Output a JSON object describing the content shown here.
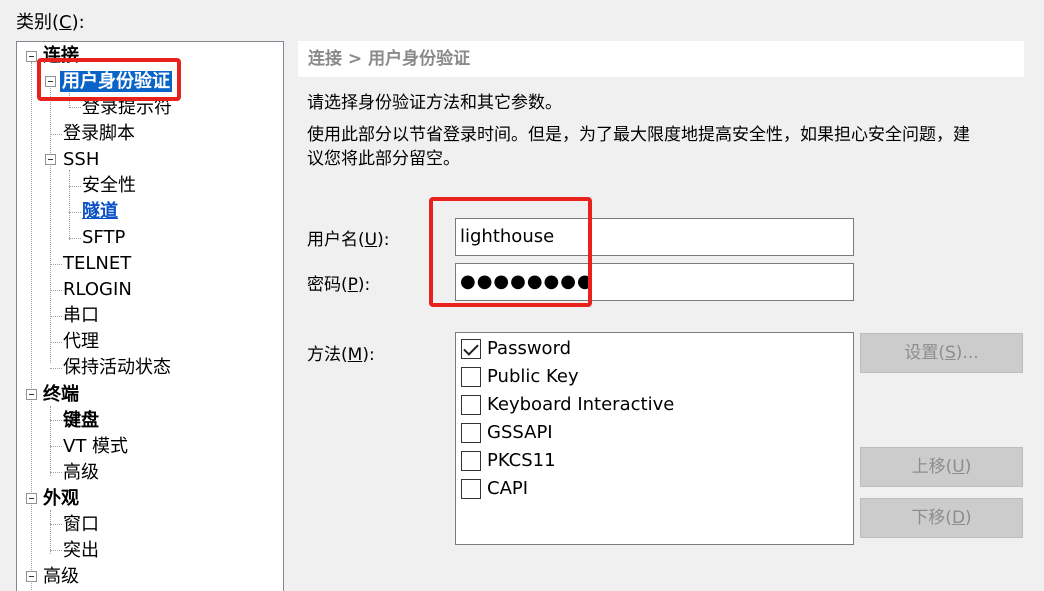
{
  "category": {
    "label": "类别(",
    "mnemonic": "C",
    "suffix": "):"
  },
  "tree": {
    "connection": "连接",
    "auth": "用户身份验证",
    "login_prompt": "登录提示符",
    "login_script": "登录脚本",
    "ssh": "SSH",
    "security": "安全性",
    "tunnel": "隧道",
    "sftp": "SFTP",
    "telnet": "TELNET",
    "rlogin": "RLOGIN",
    "serial": "串口",
    "proxy": "代理",
    "keepalive": "保持活动状态",
    "terminal": "终端",
    "keyboard": "键盘",
    "vt_mode": "VT 模式",
    "advanced_sub": "高级",
    "appearance": "外观",
    "window": "窗口",
    "highlight": "突出",
    "advanced": "高级"
  },
  "breadcrumb": "连接 > 用户身份验证",
  "description": {
    "line1": "请选择身份验证方法和其它参数。",
    "line2a": "使用此部分以节省登录时间。但是，为了最大限度地提高安全性，如果担心安全问题，建",
    "line2b": "议您将此部分留空。"
  },
  "username": {
    "label": "用户名(",
    "mnemonic": "U",
    "suffix": "):",
    "value": "lighthouse"
  },
  "password": {
    "label": "密码(",
    "mnemonic": "P",
    "suffix": "):",
    "value": "●●●●●●●●"
  },
  "method": {
    "label": "方法(",
    "mnemonic": "M",
    "suffix": "):",
    "items": [
      {
        "name": "Password",
        "checked": true
      },
      {
        "name": "Public Key",
        "checked": false
      },
      {
        "name": "Keyboard Interactive",
        "checked": false
      },
      {
        "name": "GSSAPI",
        "checked": false
      },
      {
        "name": "PKCS11",
        "checked": false
      },
      {
        "name": "CAPI",
        "checked": false
      }
    ]
  },
  "buttons": {
    "settings": {
      "label": "设置(",
      "mnemonic": "S",
      "suffix": ")..."
    },
    "move_up": {
      "label": "上移(",
      "mnemonic": "U",
      "suffix": ")"
    },
    "move_down": {
      "label": "下移(",
      "mnemonic": "D",
      "suffix": ")"
    }
  },
  "colors": {
    "highlight_box": "#e8211c",
    "selection": "#0a64c8",
    "link": "#0a50c8"
  }
}
